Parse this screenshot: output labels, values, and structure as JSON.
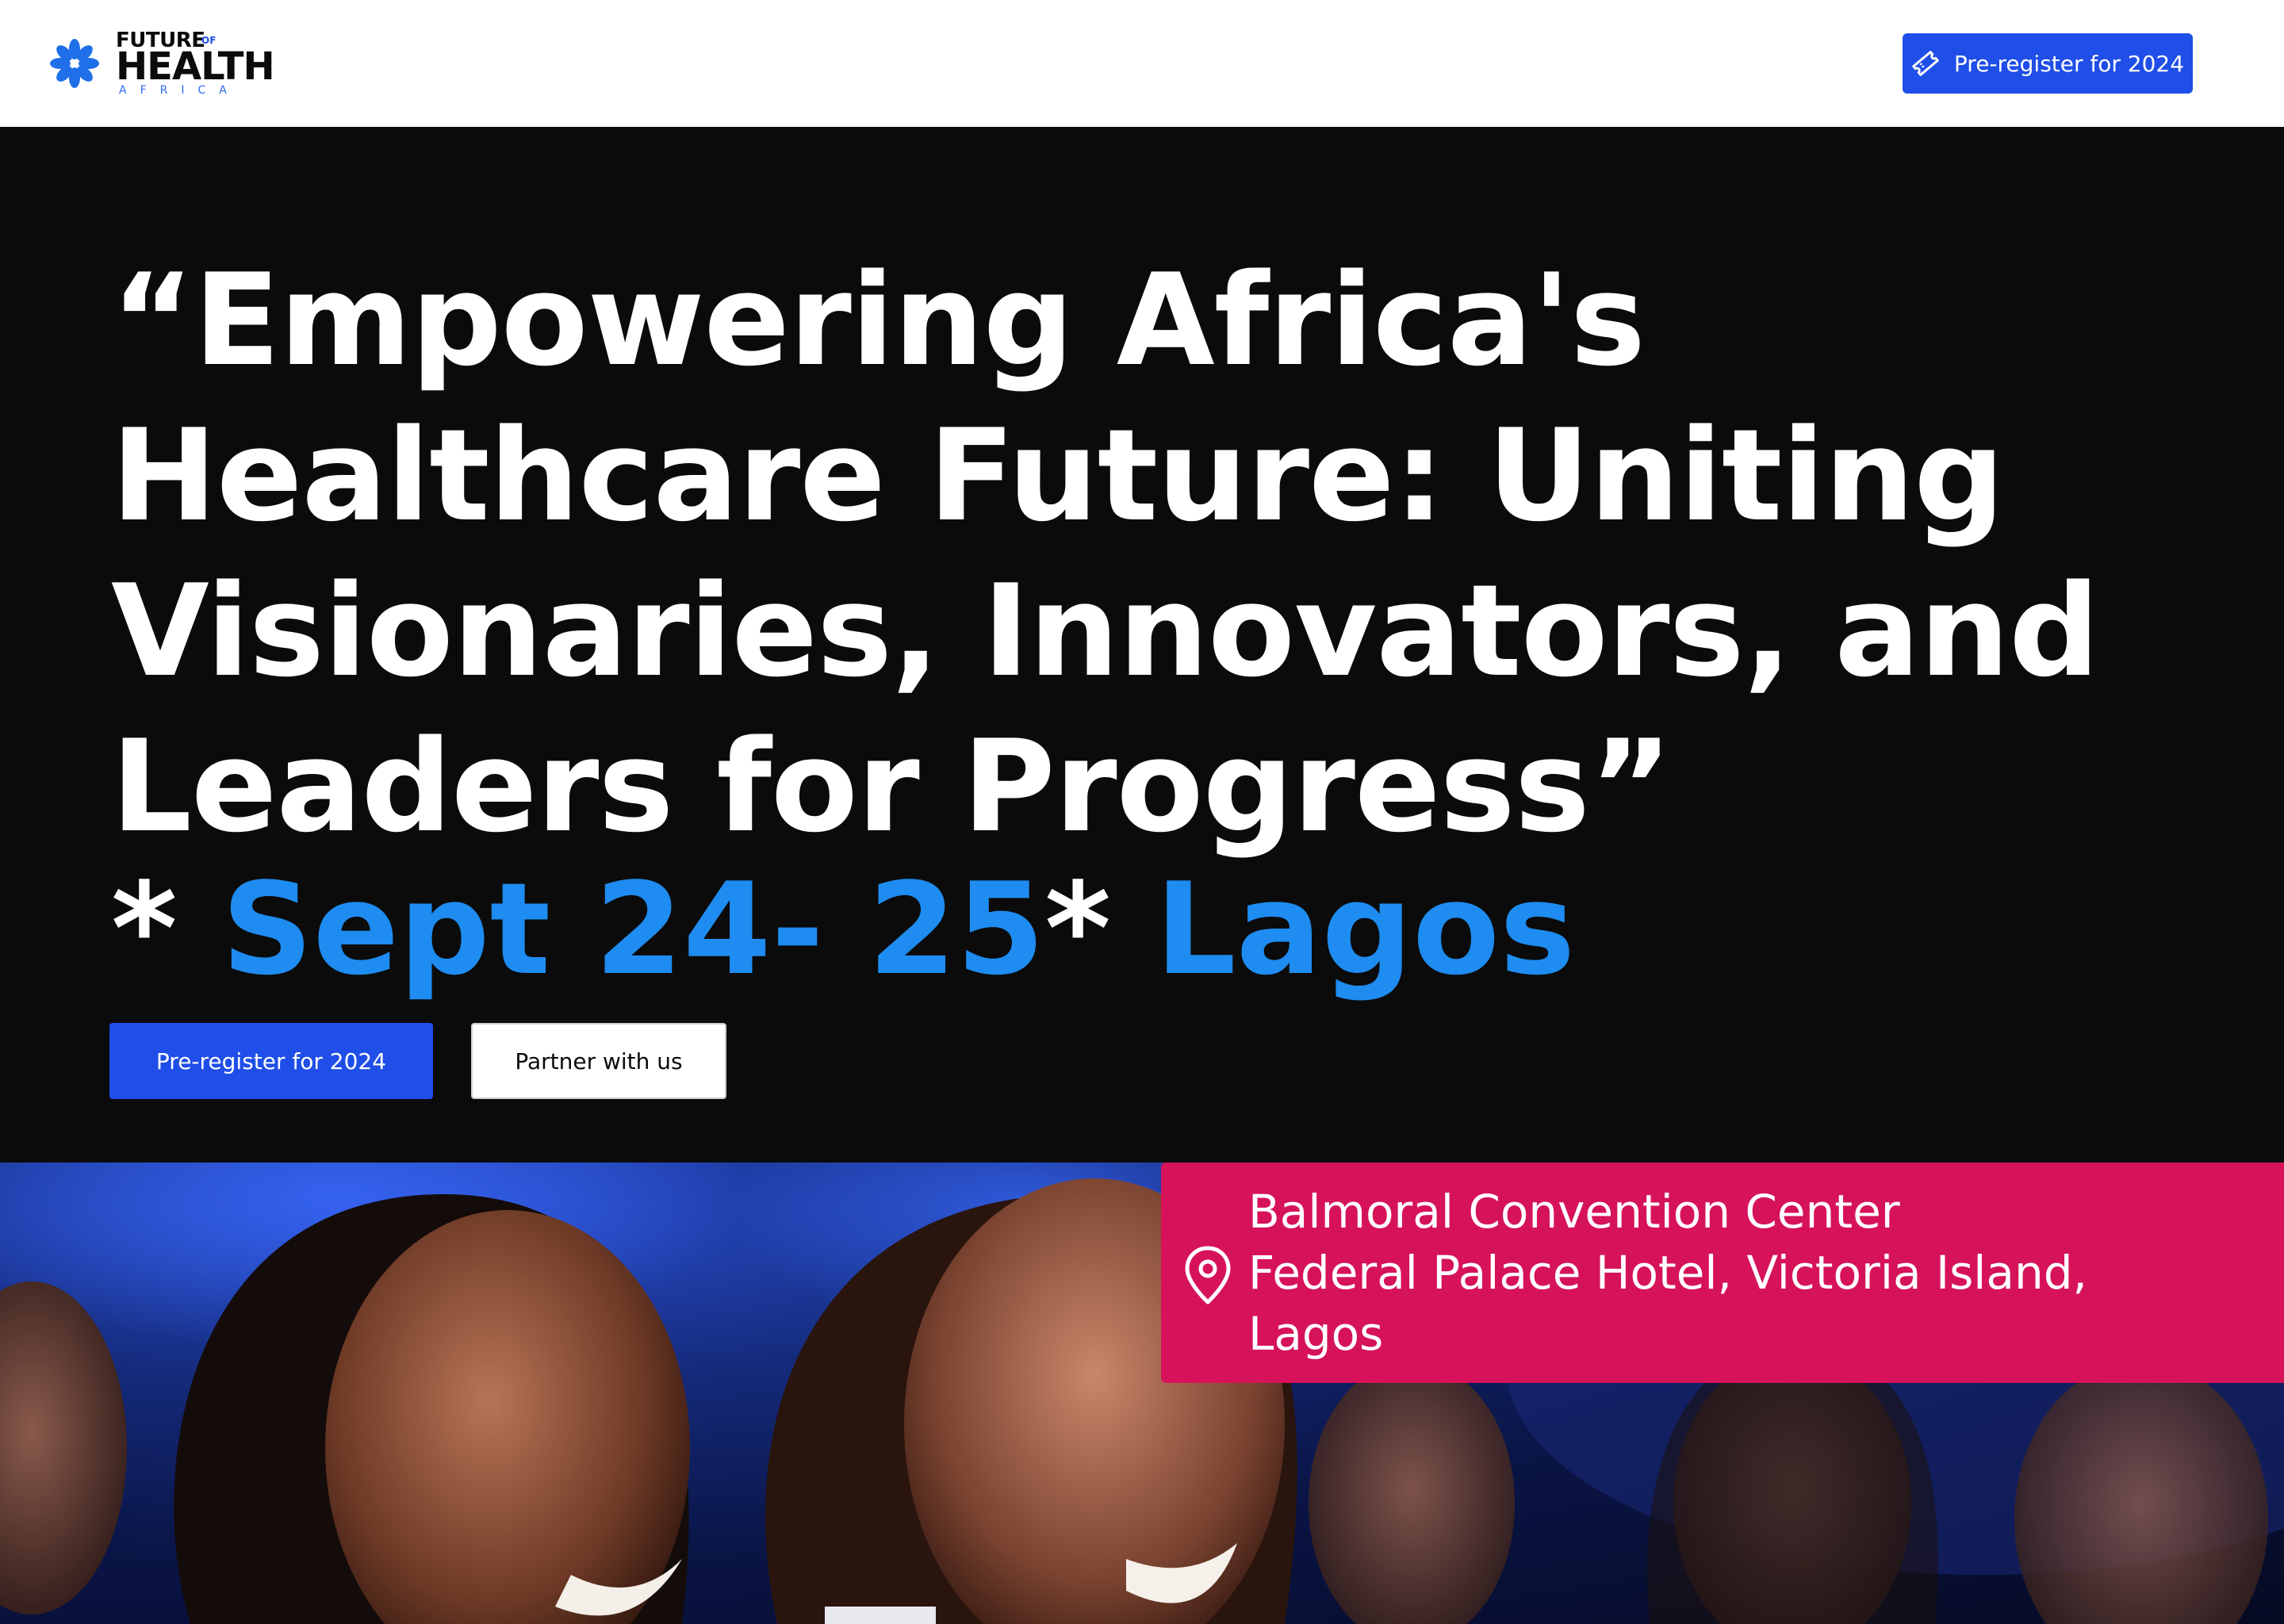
{
  "header": {
    "logo": {
      "line1": "FUTURE",
      "of": "OF",
      "line2": "HEALTH",
      "line3": "AFRICA"
    },
    "cta_label": "Pre-register for 2024",
    "cta_icon": "ticket-icon"
  },
  "hero": {
    "headline": "“Empowering Africa's Healthcare Future: Uniting Visionaries, Innovators, and Leaders for Progress”",
    "date_prefix": "* ",
    "date_text": "Sept 24- 25",
    "date_suffix": "* ",
    "city": "Lagos",
    "primary_button": "Pre-register for 2024",
    "secondary_button": "Partner with us"
  },
  "venue": {
    "icon": "location-pin-icon",
    "lines": [
      "Balmoral Convention Center",
      "Federal Palace Hotel, Victoria Island,",
      "Lagos"
    ]
  },
  "colors": {
    "brand_blue": "#1f4ee8",
    "accent_blue": "#1e8cf0",
    "venue_pink": "#d6135a",
    "hero_bg": "#0b0b0b"
  }
}
